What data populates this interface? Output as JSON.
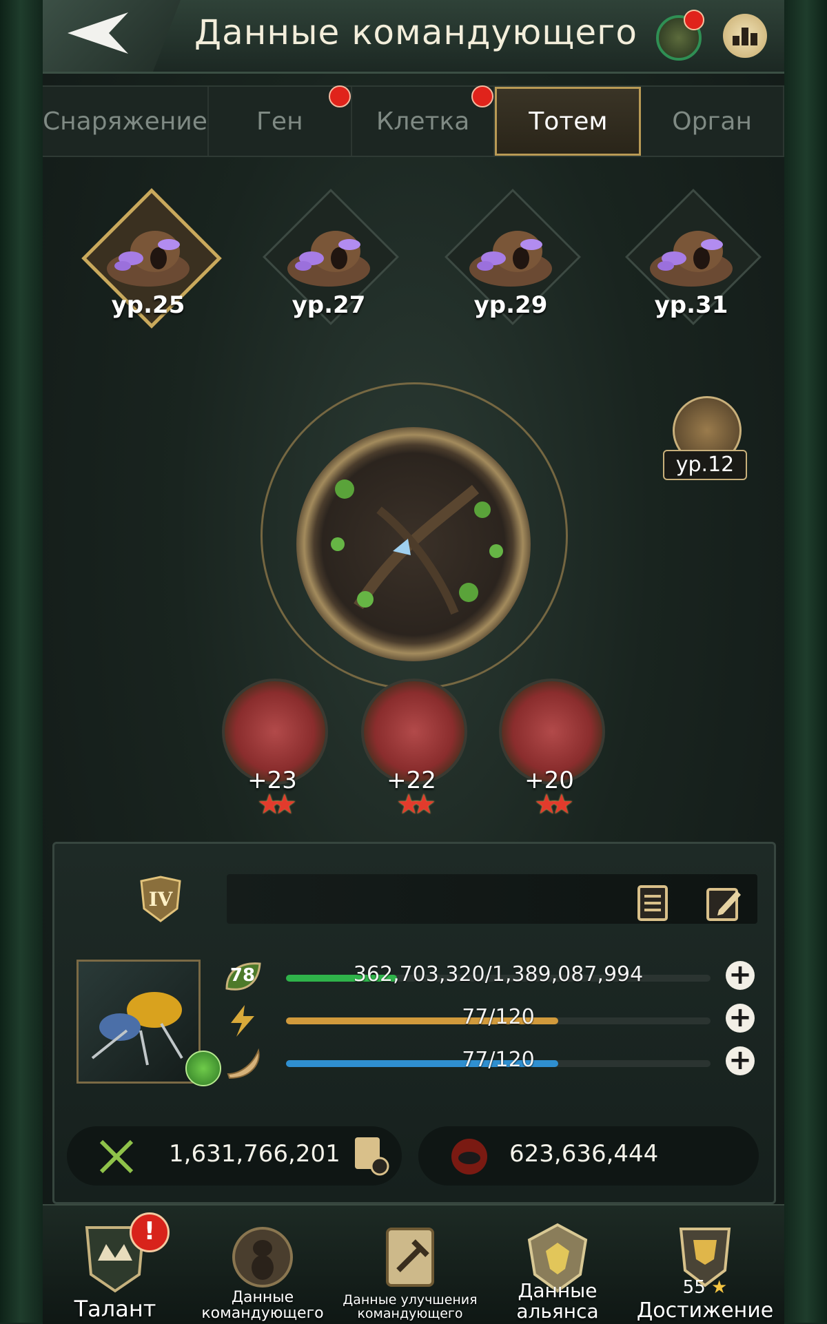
{
  "header": {
    "title": "Данные командующего"
  },
  "tabs": [
    {
      "label": "Снаряжение",
      "active": false,
      "badge": false
    },
    {
      "label": "Ген",
      "active": false,
      "badge": true
    },
    {
      "label": "Клетка",
      "active": false,
      "badge": true
    },
    {
      "label": "Тотем",
      "active": true,
      "badge": false
    },
    {
      "label": "Орган",
      "active": false,
      "badge": false
    }
  ],
  "totem_levels": [
    {
      "label": "ур.25",
      "selected": true
    },
    {
      "label": "ур.27",
      "selected": false
    },
    {
      "label": "ур.29",
      "selected": false
    },
    {
      "label": "ур.31",
      "selected": false
    }
  ],
  "side_badge": {
    "label": "ур.12"
  },
  "skills": [
    {
      "value": "+23",
      "stars": 2,
      "icon": "claw-icon"
    },
    {
      "value": "+22",
      "stars": 2,
      "icon": "shield-icon"
    },
    {
      "value": "+20",
      "stars": 2,
      "icon": "heart-icon"
    }
  ],
  "commander": {
    "rank": "IV",
    "level": "78",
    "exp_text": "362,703,320/1,389,087,994",
    "exp_fraction": 0.261,
    "energy_text": "77/120",
    "energy_fraction": 0.642,
    "stamina_text": "77/120",
    "stamina_fraction": 0.642,
    "power": "1,631,766,201",
    "kills": "623,636,444"
  },
  "colors": {
    "exp_bar": "#2fb34a",
    "energy_bar": "#d19a3c",
    "stamina_bar": "#2f8fd0",
    "accent_gold": "#c9a95c",
    "alert_red": "#d8231b"
  },
  "bottom_nav": [
    {
      "label": "Талант",
      "icon": "talent-crown-icon",
      "alert": "!"
    },
    {
      "label": "Данные командующего",
      "icon": "commander-ant-icon"
    },
    {
      "label": "Данные улучшения командующего",
      "icon": "upgrade-scroll-icon"
    },
    {
      "label": "Данные альянса",
      "icon": "alliance-shield-icon"
    },
    {
      "label": "Достижение",
      "icon": "achievement-trophy-icon",
      "count": "55"
    }
  ]
}
